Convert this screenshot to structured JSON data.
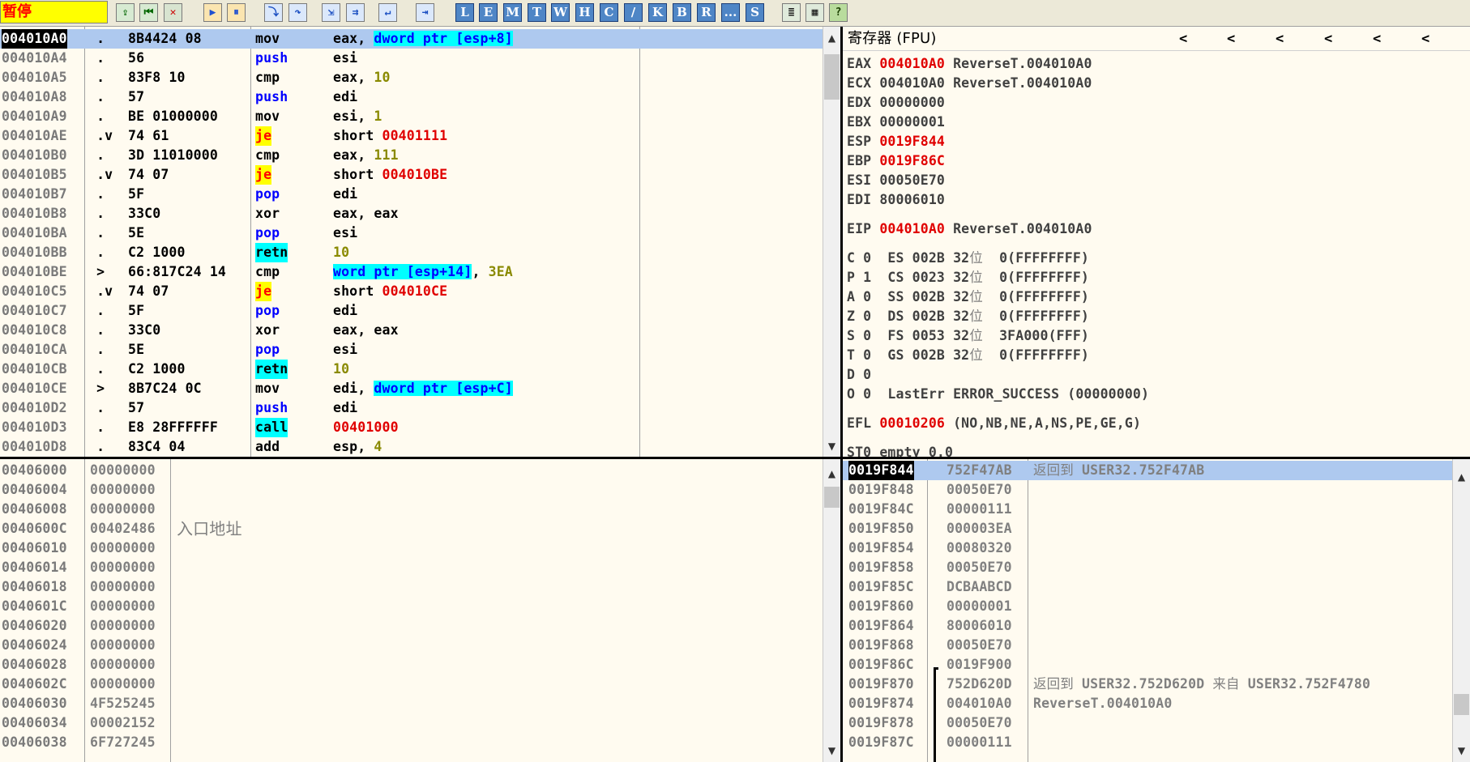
{
  "toolbar": {
    "status": "暂停",
    "buttons": [
      "open",
      "restart",
      "close",
      "run",
      "pause",
      "step-into",
      "step-over",
      "trace-into",
      "trace-over",
      "execute-till-return",
      "go-to-user-code",
      "L",
      "E",
      "M",
      "T",
      "W",
      "H",
      "C",
      "/",
      "K",
      "B",
      "R",
      "...",
      "S",
      "list",
      "colors",
      "?"
    ]
  },
  "cpu": {
    "rows": [
      {
        "addr": "004010A0",
        "mark": " .",
        "hex": "8B4424 08",
        "mn": "mov",
        "ops": [
          {
            "t": "eax, "
          },
          {
            "t": "dword ptr [esp+8]",
            "c": "cyanb"
          }
        ],
        "sel": true
      },
      {
        "addr": "004010A4",
        "mark": " .",
        "hex": "56",
        "mn": "push",
        "mnc": "blue",
        "ops": [
          {
            "t": "esi"
          }
        ]
      },
      {
        "addr": "004010A5",
        "mark": " .",
        "hex": "83F8 10",
        "mn": "cmp",
        "ops": [
          {
            "t": "eax, "
          },
          {
            "t": "10",
            "c": "olive"
          }
        ]
      },
      {
        "addr": "004010A8",
        "mark": " .",
        "hex": "57",
        "mn": "push",
        "mnc": "blue",
        "ops": [
          {
            "t": "edi"
          }
        ]
      },
      {
        "addr": "004010A9",
        "mark": " .",
        "hex": "BE 01000000",
        "mn": "mov",
        "ops": [
          {
            "t": "esi, "
          },
          {
            "t": "1",
            "c": "olive"
          }
        ]
      },
      {
        "addr": "004010AE",
        "mark": " .v",
        "hex": "74 61",
        "mn": "je",
        "mnc": "yel",
        "ops": [
          {
            "t": "short "
          },
          {
            "t": "00401111",
            "c": "red"
          }
        ]
      },
      {
        "addr": "004010B0",
        "mark": " .",
        "hex": "3D 11010000",
        "mn": "cmp",
        "ops": [
          {
            "t": "eax, "
          },
          {
            "t": "111",
            "c": "olive"
          }
        ]
      },
      {
        "addr": "004010B5",
        "mark": " .v",
        "hex": "74 07",
        "mn": "je",
        "mnc": "yel",
        "ops": [
          {
            "t": "short "
          },
          {
            "t": "004010BE",
            "c": "red"
          }
        ]
      },
      {
        "addr": "004010B7",
        "mark": " .",
        "hex": "5F",
        "mn": "pop",
        "mnc": "blue",
        "ops": [
          {
            "t": "edi"
          }
        ]
      },
      {
        "addr": "004010B8",
        "mark": " .",
        "hex": "33C0",
        "mn": "xor",
        "ops": [
          {
            "t": "eax, eax"
          }
        ]
      },
      {
        "addr": "004010BA",
        "mark": " .",
        "hex": "5E",
        "mn": "pop",
        "mnc": "blue",
        "ops": [
          {
            "t": "esi"
          }
        ]
      },
      {
        "addr": "004010BB",
        "mark": " .",
        "hex": "C2 1000",
        "mn": "retn",
        "mnc": "cyan",
        "ops": [
          {
            "t": "10",
            "c": "olive"
          }
        ]
      },
      {
        "addr": "004010BE",
        "mark": " >",
        "hex": "66:817C24 14",
        "mn": "cmp",
        "ops": [
          {
            "t": "word ptr [esp+14]",
            "c": "cyanb"
          },
          {
            "t": ", "
          },
          {
            "t": "3EA",
            "c": "olive"
          }
        ]
      },
      {
        "addr": "004010C5",
        "mark": " .v",
        "hex": "74 07",
        "mn": "je",
        "mnc": "yel",
        "ops": [
          {
            "t": "short "
          },
          {
            "t": "004010CE",
            "c": "red"
          }
        ]
      },
      {
        "addr": "004010C7",
        "mark": " .",
        "hex": "5F",
        "mn": "pop",
        "mnc": "blue",
        "ops": [
          {
            "t": "edi"
          }
        ]
      },
      {
        "addr": "004010C8",
        "mark": " .",
        "hex": "33C0",
        "mn": "xor",
        "ops": [
          {
            "t": "eax, eax"
          }
        ]
      },
      {
        "addr": "004010CA",
        "mark": " .",
        "hex": "5E",
        "mn": "pop",
        "mnc": "blue",
        "ops": [
          {
            "t": "esi"
          }
        ]
      },
      {
        "addr": "004010CB",
        "mark": " .",
        "hex": "C2 1000",
        "mn": "retn",
        "mnc": "cyan",
        "ops": [
          {
            "t": "10",
            "c": "olive"
          }
        ]
      },
      {
        "addr": "004010CE",
        "mark": " >",
        "hex": "8B7C24 0C",
        "mn": "mov",
        "ops": [
          {
            "t": "edi, "
          },
          {
            "t": "dword ptr [esp+C]",
            "c": "cyanb"
          }
        ]
      },
      {
        "addr": "004010D2",
        "mark": " .",
        "hex": "57",
        "mn": "push",
        "mnc": "blue",
        "ops": [
          {
            "t": "edi"
          }
        ]
      },
      {
        "addr": "004010D3",
        "mark": " .",
        "hex": "E8 28FFFFFF",
        "mn": "call",
        "mnc": "cyan",
        "ops": [
          {
            "t": "00401000",
            "c": "red"
          }
        ]
      },
      {
        "addr": "004010D8",
        "mark": " .",
        "hex": "83C4 04",
        "mn": "add",
        "ops": [
          {
            "t": "esp, "
          },
          {
            "t": "4",
            "c": "olive"
          }
        ]
      }
    ]
  },
  "registers": {
    "header": "寄存器 (FPU)",
    "lines": [
      [
        {
          "t": "EAX "
        },
        {
          "t": "004010A0",
          "c": "red"
        },
        {
          "t": " ReverseT.004010A0"
        }
      ],
      [
        {
          "t": "ECX 004010A0 ReverseT.004010A0"
        }
      ],
      [
        {
          "t": "EDX 00000000"
        }
      ],
      [
        {
          "t": "EBX 00000001"
        }
      ],
      [
        {
          "t": "ESP "
        },
        {
          "t": "0019F844",
          "c": "red"
        }
      ],
      [
        {
          "t": "EBP "
        },
        {
          "t": "0019F86C",
          "c": "red"
        }
      ],
      [
        {
          "t": "ESI 00050E70"
        }
      ],
      [
        {
          "t": "EDI 80006010"
        }
      ],
      null,
      [
        {
          "t": "EIP "
        },
        {
          "t": "004010A0",
          "c": "red"
        },
        {
          "t": " ReverseT.004010A0"
        }
      ],
      null,
      [
        {
          "t": "C 0  ES 002B 32"
        },
        {
          "t": "位",
          "c": "cjk"
        },
        {
          "t": "  0(FFFFFFFF)"
        }
      ],
      [
        {
          "t": "P 1  CS 0023 32"
        },
        {
          "t": "位",
          "c": "cjk"
        },
        {
          "t": "  0(FFFFFFFF)"
        }
      ],
      [
        {
          "t": "A 0  SS 002B 32"
        },
        {
          "t": "位",
          "c": "cjk"
        },
        {
          "t": "  0(FFFFFFFF)"
        }
      ],
      [
        {
          "t": "Z 0  DS 002B 32"
        },
        {
          "t": "位",
          "c": "cjk"
        },
        {
          "t": "  0(FFFFFFFF)"
        }
      ],
      [
        {
          "t": "S 0  FS 0053 32"
        },
        {
          "t": "位",
          "c": "cjk"
        },
        {
          "t": "  3FA000(FFF)"
        }
      ],
      [
        {
          "t": "T 0  GS 002B 32"
        },
        {
          "t": "位",
          "c": "cjk"
        },
        {
          "t": "  0(FFFFFFFF)"
        }
      ],
      [
        {
          "t": "D 0"
        }
      ],
      [
        {
          "t": "O 0  LastErr ERROR_SUCCESS (00000000)"
        }
      ],
      null,
      [
        {
          "t": "EFL "
        },
        {
          "t": "00010206",
          "c": "red"
        },
        {
          "t": " (NO,NB,NE,A,NS,PE,GE,G)"
        }
      ],
      null,
      [
        {
          "t": "ST0 empty 0.0"
        }
      ]
    ]
  },
  "dump": {
    "rows": [
      {
        "addr": "00406000",
        "hex": "00000000",
        "cmt": ""
      },
      {
        "addr": "00406004",
        "hex": "00000000",
        "cmt": ""
      },
      {
        "addr": "00406008",
        "hex": "00000000",
        "cmt": ""
      },
      {
        "addr": "0040600C",
        "hex": "00402486",
        "cmt": "入口地址"
      },
      {
        "addr": "00406010",
        "hex": "00000000",
        "cmt": ""
      },
      {
        "addr": "00406014",
        "hex": "00000000",
        "cmt": ""
      },
      {
        "addr": "00406018",
        "hex": "00000000",
        "cmt": ""
      },
      {
        "addr": "0040601C",
        "hex": "00000000",
        "cmt": ""
      },
      {
        "addr": "00406020",
        "hex": "00000000",
        "cmt": ""
      },
      {
        "addr": "00406024",
        "hex": "00000000",
        "cmt": ""
      },
      {
        "addr": "00406028",
        "hex": "00000000",
        "cmt": ""
      },
      {
        "addr": "0040602C",
        "hex": "00000000",
        "cmt": ""
      },
      {
        "addr": "00406030",
        "hex": "4F525245",
        "cmt": ""
      },
      {
        "addr": "00406034",
        "hex": "00002152",
        "cmt": ""
      },
      {
        "addr": "00406038",
        "hex": "6F727245",
        "cmt": ""
      }
    ]
  },
  "stack": {
    "rows": [
      {
        "addr": "0019F844",
        "val": "752F47AB",
        "cmt": [
          {
            "t": "返回到",
            "c": "cjk"
          },
          {
            "t": " USER32.752F47AB"
          }
        ],
        "sel": true
      },
      {
        "addr": "0019F848",
        "val": "00050E70",
        "cmt": []
      },
      {
        "addr": "0019F84C",
        "val": "00000111",
        "cmt": []
      },
      {
        "addr": "0019F850",
        "val": "000003EA",
        "cmt": []
      },
      {
        "addr": "0019F854",
        "val": "00080320",
        "cmt": []
      },
      {
        "addr": "0019F858",
        "val": "00050E70",
        "cmt": []
      },
      {
        "addr": "0019F85C",
        "val": "DCBAABCD",
        "cmt": []
      },
      {
        "addr": "0019F860",
        "val": "00000001",
        "cmt": []
      },
      {
        "addr": "0019F864",
        "val": "80006010",
        "cmt": []
      },
      {
        "addr": "0019F868",
        "val": "00050E70",
        "cmt": []
      },
      {
        "addr": "0019F86C",
        "val": "0019F900",
        "cmt": []
      },
      {
        "addr": "0019F870",
        "val": "752D620D",
        "cmt": [
          {
            "t": "返回到",
            "c": "cjk"
          },
          {
            "t": " USER32.752D620D "
          },
          {
            "t": "来自",
            "c": "cjk"
          },
          {
            "t": " USER32.752F4780"
          }
        ]
      },
      {
        "addr": "0019F874",
        "val": "004010A0",
        "cmt": [
          {
            "t": "ReverseT.004010A0"
          }
        ]
      },
      {
        "addr": "0019F878",
        "val": "00050E70",
        "cmt": []
      },
      {
        "addr": "0019F87C",
        "val": "00000111",
        "cmt": []
      }
    ]
  }
}
